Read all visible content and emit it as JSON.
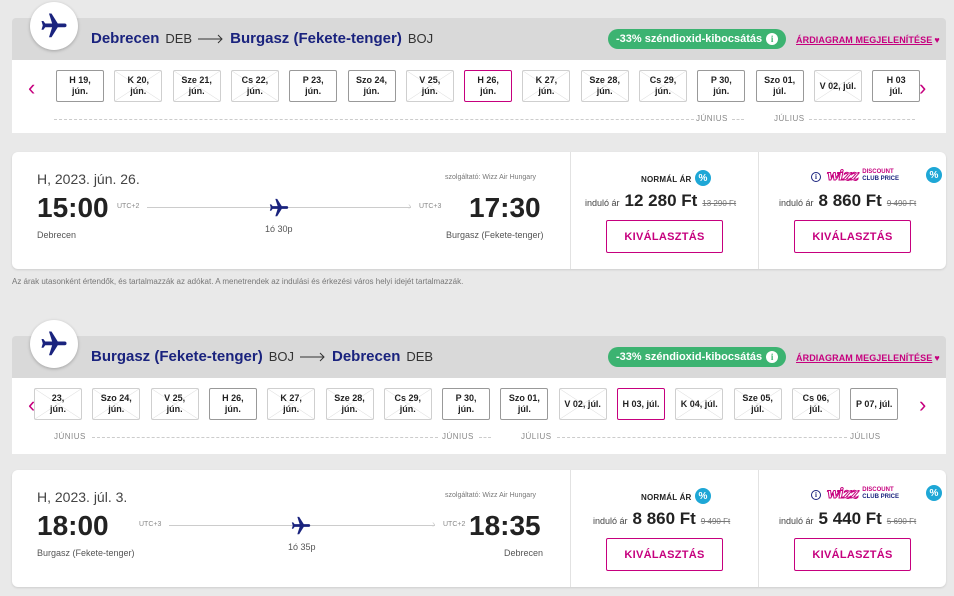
{
  "outbound": {
    "route": {
      "from_city": "Debrecen",
      "from_code": "DEB",
      "to_city": "Burgasz (Fekete-tenger)",
      "to_code": "BOJ"
    },
    "co2_label": "-33% széndioxid-kibocsátás",
    "price_diagram_label": "ÁRDIAGRAM MEGJELENÍTÉSE",
    "dates": [
      {
        "l1": "H 19,",
        "l2": "jún.",
        "state": "avail"
      },
      {
        "l1": "K 20,",
        "l2": "jún.",
        "state": "crossed"
      },
      {
        "l1": "Sze 21,",
        "l2": "jún.",
        "state": "crossed"
      },
      {
        "l1": "Cs 22,",
        "l2": "jún.",
        "state": "crossed"
      },
      {
        "l1": "P 23,",
        "l2": "jún.",
        "state": "avail"
      },
      {
        "l1": "Szo 24,",
        "l2": "jún.",
        "state": "avail"
      },
      {
        "l1": "V 25,",
        "l2": "jún.",
        "state": "crossed"
      },
      {
        "l1": "H 26,",
        "l2": "jún.",
        "state": "selected"
      },
      {
        "l1": "K 27,",
        "l2": "jún.",
        "state": "crossed"
      },
      {
        "l1": "Sze 28,",
        "l2": "jún.",
        "state": "crossed"
      },
      {
        "l1": "Cs 29,",
        "l2": "jún.",
        "state": "crossed"
      },
      {
        "l1": "P 30,",
        "l2": "jún.",
        "state": "avail"
      },
      {
        "l1": "Szo 01,",
        "l2": "júl.",
        "state": "avail"
      },
      {
        "l1": "V 02, júl.",
        "l2": "",
        "state": "crossed"
      },
      {
        "l1": "H 03",
        "l2": "júl.",
        "state": "avail"
      }
    ],
    "months": [
      "JÚNIUS",
      "JÚLIUS"
    ],
    "flight": {
      "date": "H, 2023. jún. 26.",
      "operator": "szolgáltató: Wizz Air Hungary",
      "depart_time": "15:00",
      "depart_tz": "UTC+2",
      "depart_city": "Debrecen",
      "arrive_time": "17:30",
      "arrive_tz": "UTC+3",
      "arrive_city": "Burgasz (Fekete-tenger)",
      "duration": "1ó 30p"
    },
    "fares": {
      "normal_label": "NORMÁL ÁR",
      "normal_prefix": "induló ár",
      "normal_price": "12 280 Ft",
      "normal_old": "13 290 Ft",
      "club_prefix": "induló ár",
      "club_price": "8 860 Ft",
      "club_old": "9 490 Ft",
      "select_label": "KIVÁLASZTÁS"
    }
  },
  "disclaimer": "Az árak utasonként értendők, és tartalmazzák az adókat. A menetrendek az indulási és érkezési város helyi idejét tartalmazzák.",
  "inbound": {
    "route": {
      "from_city": "Burgasz (Fekete-tenger)",
      "from_code": "BOJ",
      "to_city": "Debrecen",
      "to_code": "DEB"
    },
    "co2_label": "-33% széndioxid-kibocsátás",
    "price_diagram_label": "ÁRDIAGRAM MEGJELENÍTÉSE",
    "dates": [
      {
        "l1": "23,",
        "l2": "jún.",
        "state": "crossed"
      },
      {
        "l1": "Szo 24,",
        "l2": "jún.",
        "state": "crossed"
      },
      {
        "l1": "V 25,",
        "l2": "jún.",
        "state": "crossed"
      },
      {
        "l1": "H 26,",
        "l2": "jún.",
        "state": "avail"
      },
      {
        "l1": "K 27,",
        "l2": "jún.",
        "state": "crossed"
      },
      {
        "l1": "Sze 28,",
        "l2": "jún.",
        "state": "crossed"
      },
      {
        "l1": "Cs 29,",
        "l2": "jún.",
        "state": "crossed"
      },
      {
        "l1": "P 30,",
        "l2": "jún.",
        "state": "avail"
      },
      {
        "l1": "Szo 01,",
        "l2": "júl.",
        "state": "avail"
      },
      {
        "l1": "V 02, júl.",
        "l2": "",
        "state": "crossed"
      },
      {
        "l1": "H 03, júl.",
        "l2": "",
        "state": "selected"
      },
      {
        "l1": "K 04, júl.",
        "l2": "",
        "state": "crossed"
      },
      {
        "l1": "Sze 05,",
        "l2": "júl.",
        "state": "crossed"
      },
      {
        "l1": "Cs 06,",
        "l2": "júl.",
        "state": "crossed"
      },
      {
        "l1": "P 07, júl.",
        "l2": "",
        "state": "avail"
      }
    ],
    "months": [
      "JÚNIUS",
      "JÚNIUS",
      "JÚLIUS",
      "JÚLIUS"
    ],
    "flight": {
      "date": "H, 2023. júl. 3.",
      "operator": "szolgáltató: Wizz Air Hungary",
      "depart_time": "18:00",
      "depart_tz": "UTC+3",
      "depart_city": "Burgasz (Fekete-tenger)",
      "arrive_time": "18:35",
      "arrive_tz": "UTC+2",
      "arrive_city": "Debrecen",
      "duration": "1ó 35p"
    },
    "fares": {
      "normal_label": "NORMÁL ÁR",
      "normal_prefix": "induló ár",
      "normal_price": "8 860 Ft",
      "normal_old": "9 490 Ft",
      "club_prefix": "induló ár",
      "club_price": "5 440 Ft",
      "club_old": "5 690 Ft",
      "select_label": "KIVÁLASZTÁS"
    }
  },
  "club_logo": {
    "wizz": "wizz",
    "line1": "DISCOUNT",
    "line2": "CLUB PRICE"
  },
  "colors": {
    "brand_navy": "#1a237e",
    "brand_magenta": "#c6007e",
    "co2_green": "#3cb371",
    "pct_blue": "#1ea7d6"
  },
  "icons": {
    "plane": "airplane-icon",
    "info": "info-icon",
    "percent": "percent-badge-icon",
    "heart": "heart-icon",
    "prev": "chevron-left-icon",
    "next": "chevron-right-icon"
  }
}
